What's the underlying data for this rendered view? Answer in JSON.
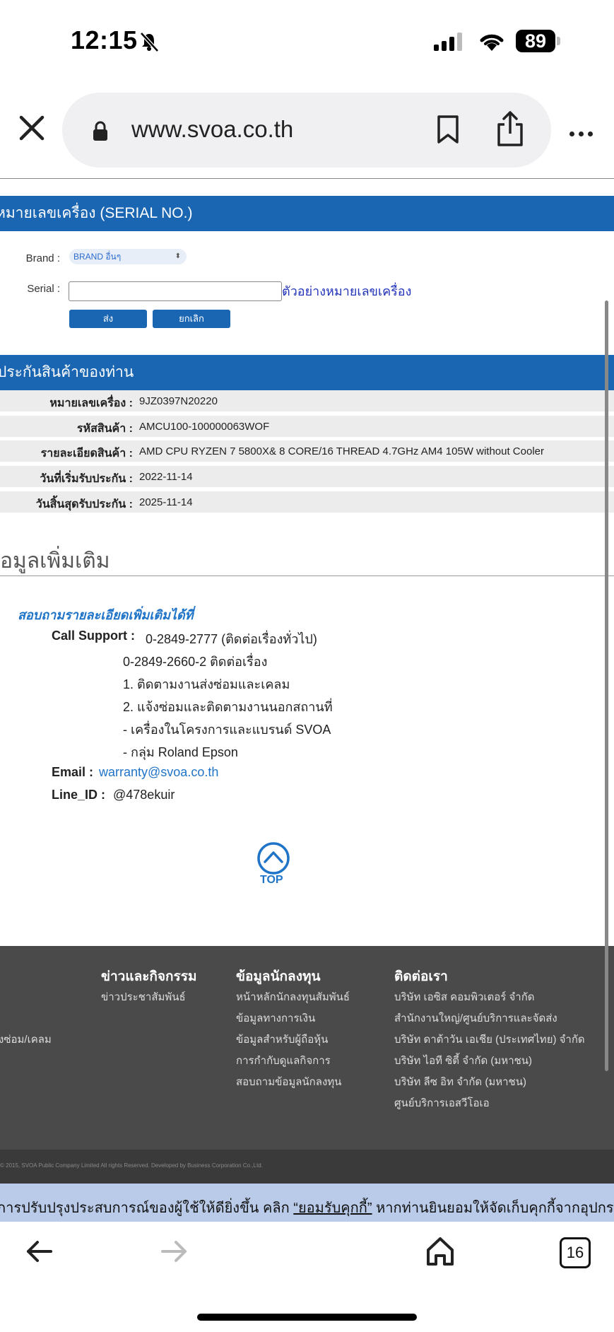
{
  "status_bar": {
    "time": "12:15",
    "battery": "89"
  },
  "browser": {
    "url": "www.svoa.co.th",
    "tabs_count": "16"
  },
  "serial_section": {
    "title": "หมายเลขเครื่อง (SERIAL NO.)",
    "brand_label": "Brand :",
    "brand_selected": "BRAND อื่นๆ",
    "serial_label": "Serial :",
    "serial_value": "",
    "example_link": "ตัวอย่างหมายเลขเครื่อง",
    "submit_label": "ส่ง",
    "cancel_label": "ยกเลิก"
  },
  "warranty_section": {
    "title": "ประกันสินค้าของท่าน",
    "rows": [
      {
        "label": "หมายเลขเครื่อง :",
        "value": "9JZ0397N20220"
      },
      {
        "label": "รหัสสินค้า :",
        "value": "AMCU100-100000063WOF"
      },
      {
        "label": "รายละเอียดสินค้า :",
        "value": "AMD CPU RYZEN 7 5800X& 8 CORE/16 THREAD 4.7GHz AM4 105W without Cooler"
      },
      {
        "label": "วันที่เริ่มรับประกัน :",
        "value": "2022-11-14"
      },
      {
        "label": "วันสิ้นสุดรับประกัน :",
        "value": "2025-11-14"
      }
    ]
  },
  "more_info": {
    "title": "อมูลเพิ่มเติม",
    "contact_heading": "สอบถามรายละเอียดเพิ่มเติมได้ที่",
    "call_support_label": "Call Support :",
    "call_support_value": "0-2849-2777 (ติดต่อเรื่องทั่วไป)",
    "call_lines": [
      "0-2849-2660-2 ติดต่อเรื่อง",
      "1. ติดตามงานส่งซ่อมและเคลม",
      "2. แจ้งซ่อมและติดตามงานนอกสถานที่",
      "- เครื่องในโครงการและแบรนด์ SVOA",
      "- กลุ่ม Roland Epson"
    ],
    "email_label": "Email :",
    "email_value": "warranty@svoa.co.th",
    "line_label": "Line_ID :",
    "line_value": "@478ekuir",
    "top_label": "TOP"
  },
  "footer": {
    "partial_item": "งซ่อม/เคลม",
    "columns": [
      {
        "heading": "ข่าวและกิจกรรม",
        "items": [
          "ข่าวประชาสัมพันธ์"
        ]
      },
      {
        "heading": "ข้อมูลนักลงทุน",
        "items": [
          "หน้าหลักนักลงทุนสัมพันธ์",
          "ข้อมูลทางการเงิน",
          "ข้อมูลสำหรับผู้ถือหุ้น",
          "การกำกับดูแลกิจการ",
          "สอบถามข้อมูลนักลงทุน"
        ]
      },
      {
        "heading": "ติดต่อเรา",
        "items": [
          "บริษัท เอซิส คอมพิวเตอร์ จำกัด",
          "สำนักงานใหญ่/ศูนย์บริการและจัดส่ง",
          "บริษัท ดาต้าวัน เอเชีย (ประเทศไทย) จำกัด",
          "บริษัท ไอที ซิตี้ จำกัด (มหาชน)",
          "บริษัท ลีซ อิท จำกัด (มหาชน)",
          "ศูนย์บริการเอสวีโอเอ"
        ]
      }
    ],
    "copyright": "© 2015, SVOA Public Company Limited All rights Reserved. Developed by Business Corporation Co.,Ltd."
  },
  "cookie_banner": {
    "text_before": "การปรับปรุงประสบการณ์ของผู้ใช้ให้ดียิ่งขึ้น คลิก ",
    "link_text": "“ยอมรับคุกกี้”",
    "text_after": " หากท่านยินยอมให้จัดเก็บคุกกี้จากอุปกรณ์"
  }
}
